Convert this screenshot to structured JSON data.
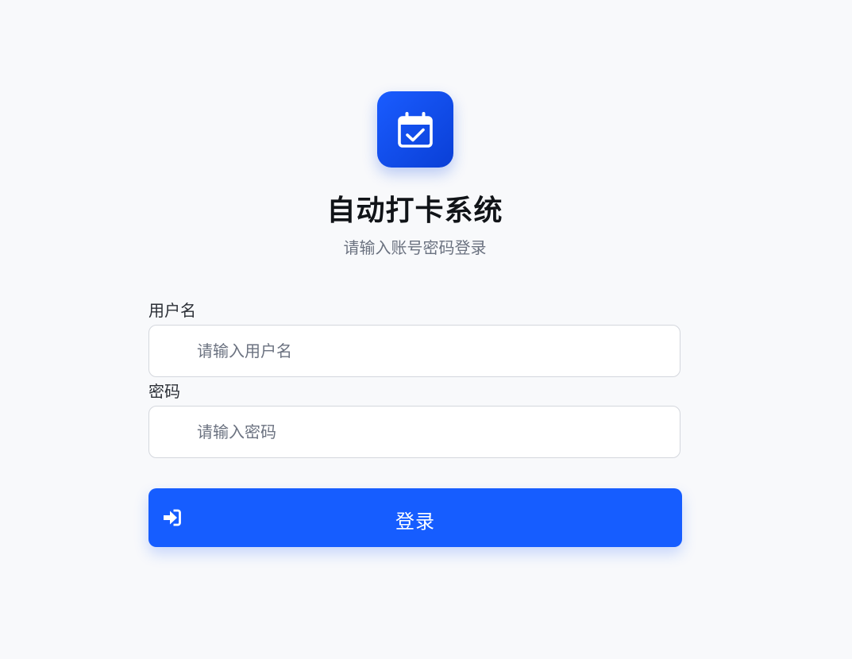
{
  "header": {
    "logo_icon": "calendar-check-icon",
    "title": "自动打卡系统",
    "subtitle": "请输入账号密码登录"
  },
  "form": {
    "username": {
      "label": "用户名",
      "placeholder": "请输入用户名",
      "value": ""
    },
    "password": {
      "label": "密码",
      "placeholder": "请输入密码",
      "value": ""
    },
    "submit": {
      "label": "登录",
      "icon": "sign-in-icon"
    }
  },
  "colors": {
    "background": "#f8f9fb",
    "accent": "#165dff",
    "logo_gradient_start": "#1a5cff",
    "logo_gradient_end": "#0a3fd6"
  }
}
